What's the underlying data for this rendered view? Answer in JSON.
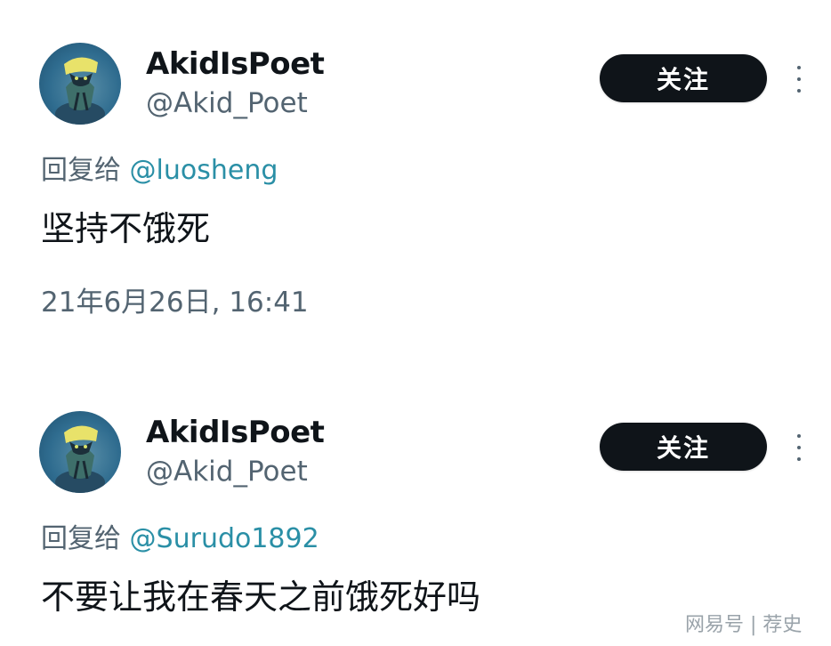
{
  "tweets": [
    {
      "display_name": "AkidIsPoet",
      "handle": "@Akid_Poet",
      "follow_label": "关注",
      "reply_prefix": "回复给 ",
      "reply_mention": "@luosheng",
      "text": "坚持不饿死",
      "timestamp": "21年6月26日, 16:41"
    },
    {
      "display_name": "AkidIsPoet",
      "handle": "@Akid_Poet",
      "follow_label": "关注",
      "reply_prefix": "回复给 ",
      "reply_mention": "@Surudo1892",
      "text": "不要让我在春天之前饿死好吗"
    }
  ],
  "watermark": "网易号 | 荐史",
  "icons": {
    "more": "more-vertical-icon",
    "avatar": "avatar-image"
  },
  "colors": {
    "follow_button_bg": "#0f1419",
    "mention": "#2a8fa6",
    "secondary_text": "#536471"
  }
}
